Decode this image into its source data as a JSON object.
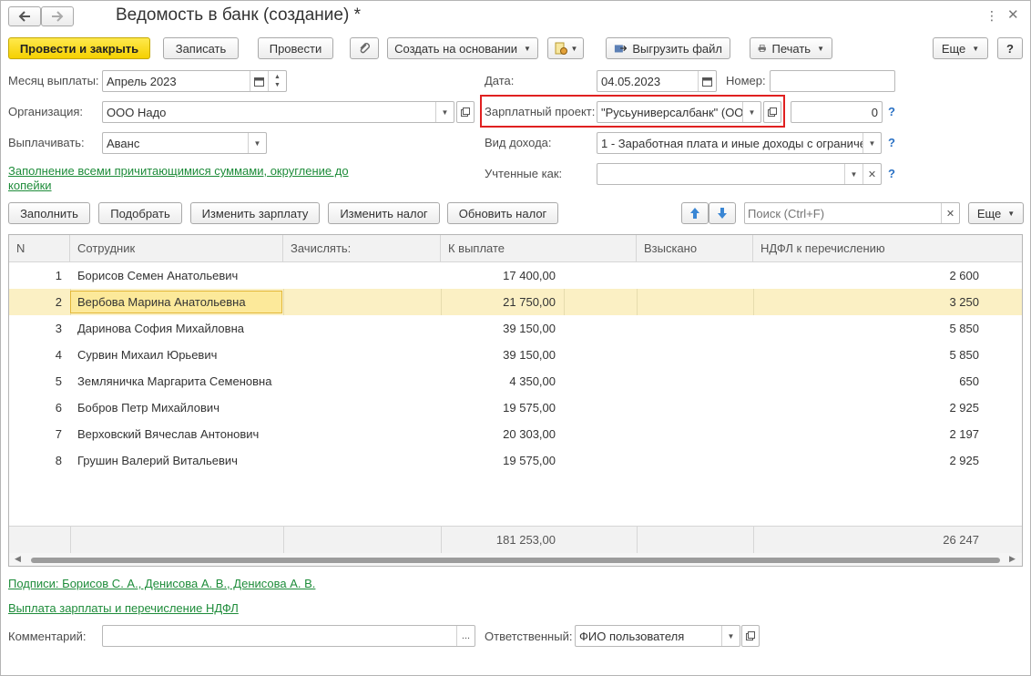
{
  "window": {
    "title": "Ведомость в банк (создание) *",
    "back_icon": "arrow-left-icon",
    "forward_icon": "arrow-right-icon"
  },
  "toolbar": {
    "post_close": "Провести и закрыть",
    "save": "Записать",
    "post": "Провести",
    "create_based": "Создать на основании",
    "export_file": "Выгрузить файл",
    "print": "Печать",
    "more": "Еще",
    "help": "?"
  },
  "form": {
    "month_label": "Месяц выплаты:",
    "month_value": "Апрель 2023",
    "date_label": "Дата:",
    "date_value": "04.05.2023",
    "number_label": "Номер:",
    "number_value": "",
    "org_label": "Организация:",
    "org_value": "ООО Надо",
    "salary_project_label": "Зарплатный проект:",
    "salary_project_value": "\"Русьуниверсалбанк\" (ОО",
    "salary_project_amount": "0",
    "pay_label": "Выплачивать:",
    "pay_value": "Аванс",
    "income_type_label": "Вид дохода:",
    "income_type_value": "1 - Заработная плата и иные доходы с ограниче",
    "accounted_label": "Учтенные как:",
    "accounted_value": "",
    "fill_link": "Заполнение всеми причитающимися суммами, округление до",
    "fill_link_2": "копейки"
  },
  "table_toolbar": {
    "fill": "Заполнить",
    "pick": "Подобрать",
    "change_salary": "Изменить зарплату",
    "change_tax": "Изменить налог",
    "update_tax": "Обновить налог",
    "search_placeholder": "Поиск (Ctrl+F)",
    "more": "Еще"
  },
  "table": {
    "columns": [
      "N",
      "Сотрудник",
      "Зачислять:",
      "К выплате",
      "Взыскано",
      "НДФЛ к перечислению"
    ],
    "rows": [
      {
        "n": "1",
        "employee": "Борисов Семен Анатольевич",
        "credit": "",
        "pay": "17 400,00",
        "recovered": "",
        "ndfl": "2 600"
      },
      {
        "n": "2",
        "employee": "Вербова Марина Анатольевна",
        "credit": "",
        "pay": "21 750,00",
        "recovered": "",
        "ndfl": "3 250"
      },
      {
        "n": "3",
        "employee": "Даринова София Михайловна",
        "credit": "",
        "pay": "39 150,00",
        "recovered": "",
        "ndfl": "5 850"
      },
      {
        "n": "4",
        "employee": "Сурвин Михаил Юрьевич",
        "credit": "",
        "pay": "39 150,00",
        "recovered": "",
        "ndfl": "5 850"
      },
      {
        "n": "5",
        "employee": "Земляничка Маргарита Семеновна",
        "credit": "",
        "pay": "4 350,00",
        "recovered": "",
        "ndfl": "650"
      },
      {
        "n": "6",
        "employee": "Бобров Петр Михайлович",
        "credit": "",
        "pay": "19 575,00",
        "recovered": "",
        "ndfl": "2 925"
      },
      {
        "n": "7",
        "employee": "Верховский Вячеслав Антонович",
        "credit": "",
        "pay": "20 303,00",
        "recovered": "",
        "ndfl": "2 197"
      },
      {
        "n": "8",
        "employee": "Грушин Валерий Витальевич",
        "credit": "",
        "pay": "19 575,00",
        "recovered": "",
        "ndfl": "2 925"
      }
    ],
    "total_pay": "181 253,00",
    "total_ndfl": "26 247",
    "selected_row": 1
  },
  "footer": {
    "signatures_link": "Подписи: Борисов С. А., Денисова А. В., Денисова А. В.",
    "payment_link": "Выплата зарплаты и перечисление НДФЛ",
    "comment_label": "Комментарий:",
    "comment_value": "",
    "responsible_label": "Ответственный:",
    "responsible_value": "ФИО пользователя"
  },
  "colors": {
    "accent_yellow": "#f5d000",
    "link_green": "#1e8c3a",
    "highlight_red": "#e02020",
    "selected_row": "#fbf0c4"
  }
}
